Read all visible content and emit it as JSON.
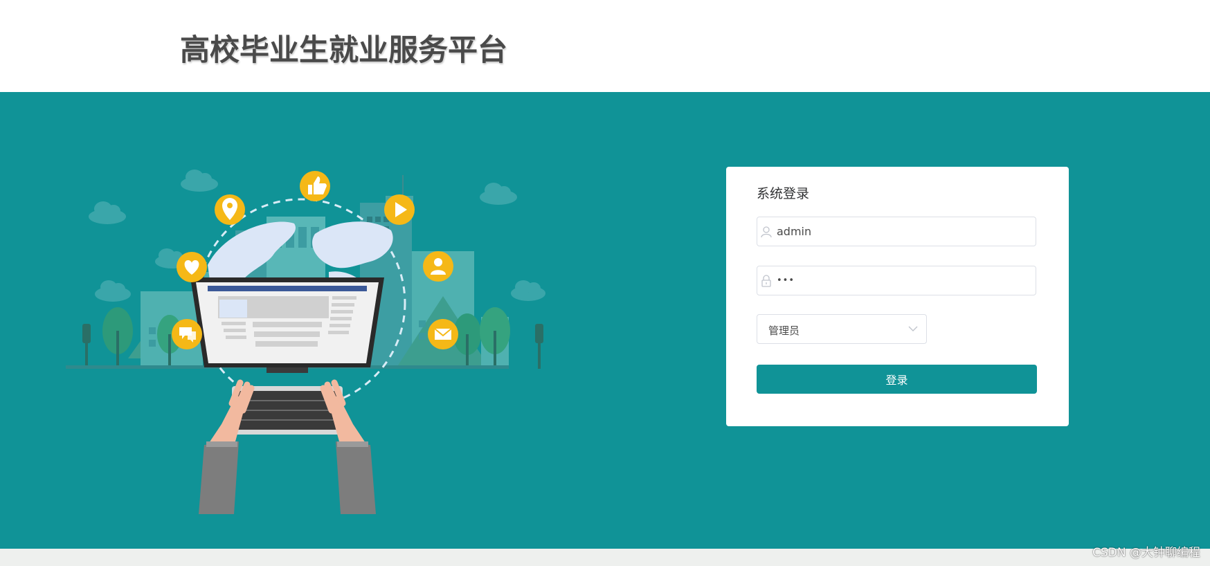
{
  "header": {
    "title": "高校毕业生就业服务平台"
  },
  "login": {
    "title": "系统登录",
    "username": {
      "value": "admin",
      "icon": "user-icon"
    },
    "password": {
      "value": "•••",
      "icon": "lock-icon"
    },
    "role": {
      "selected": "管理员",
      "icon": "chevron-down-icon"
    },
    "submit_label": "登录"
  },
  "watermark": "CSDN @大钟聊编程",
  "colors": {
    "brand": "#109397",
    "icon_accent": "#f5b817",
    "header_bg": "#ffffff",
    "title_text": "#4a4a4a"
  },
  "illustration": {
    "icons": [
      "thumbs-up-icon",
      "location-pin-icon",
      "play-icon",
      "heart-icon",
      "person-icon",
      "chat-icon",
      "mail-icon"
    ]
  }
}
